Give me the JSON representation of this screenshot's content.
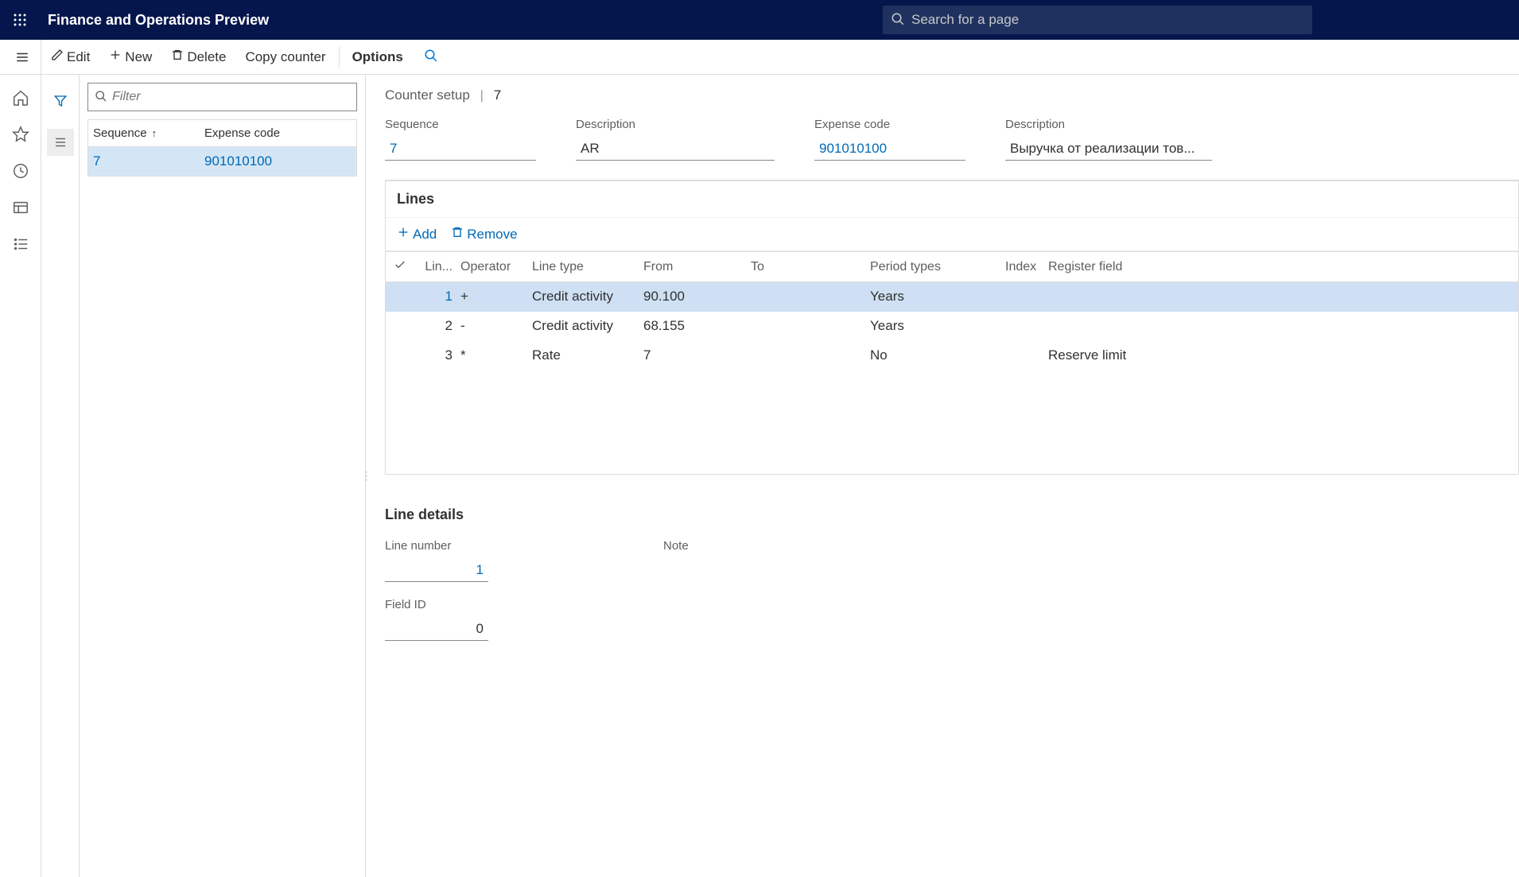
{
  "header": {
    "app_title": "Finance and Operations Preview",
    "search_placeholder": "Search for a page"
  },
  "actions": {
    "edit": "Edit",
    "new": "New",
    "delete": "Delete",
    "copy_counter": "Copy counter",
    "options": "Options"
  },
  "list": {
    "filter_placeholder": "Filter",
    "columns": {
      "sequence": "Sequence",
      "expense_code": "Expense code"
    },
    "rows": [
      {
        "sequence": "7",
        "expense_code": "901010100"
      }
    ]
  },
  "detail": {
    "breadcrumb_title": "Counter setup",
    "breadcrumb_value": "7",
    "fields": {
      "sequence_label": "Sequence",
      "sequence_value": "7",
      "description_label": "Description",
      "description_value": "AR",
      "expense_code_label": "Expense code",
      "expense_code_value": "901010100",
      "expense_desc_label": "Description",
      "expense_desc_value": "Выручка от реализации тов..."
    }
  },
  "lines": {
    "section_title": "Lines",
    "toolbar": {
      "add": "Add",
      "remove": "Remove"
    },
    "columns": {
      "line": "Lin...",
      "operator": "Operator",
      "line_type": "Line type",
      "from": "From",
      "to": "To",
      "period_types": "Period types",
      "index": "Index",
      "register_field": "Register field"
    },
    "rows": [
      {
        "line": "1",
        "operator": "+",
        "line_type": "Credit activity",
        "from": "90.100",
        "to": "",
        "period_types": "Years",
        "index": "",
        "register_field": ""
      },
      {
        "line": "2",
        "operator": "-",
        "line_type": "Credit activity",
        "from": "68.155",
        "to": "",
        "period_types": "Years",
        "index": "",
        "register_field": ""
      },
      {
        "line": "3",
        "operator": "*",
        "line_type": "Rate",
        "from": "7",
        "to": "",
        "period_types": "No",
        "index": "",
        "register_field": "Reserve limit"
      }
    ]
  },
  "line_details": {
    "title": "Line details",
    "line_number_label": "Line number",
    "line_number_value": "1",
    "field_id_label": "Field ID",
    "field_id_value": "0",
    "note_label": "Note"
  }
}
